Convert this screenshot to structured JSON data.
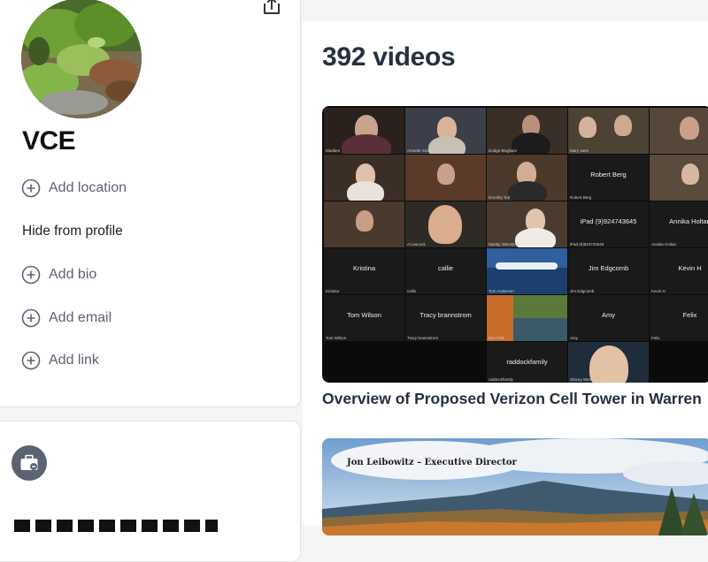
{
  "profile": {
    "name": "VCE",
    "add_location": "Add location",
    "hide_from_profile": "Hide from profile",
    "add_bio": "Add bio",
    "add_email": "Add email",
    "add_link": "Add link"
  },
  "main": {
    "video_count": "392 videos",
    "videos": [
      {
        "title": "Overview of Proposed Verizon Cell Tower in Warren",
        "participants": [
          "Kristina",
          "callie",
          "Jim Edgcomb",
          "Kevin H",
          "Tom Wilson",
          "Tracy brannstrom",
          "Amy",
          "Felix",
          "raddockfamily",
          "Robert Berg",
          "iPad (9)924743645",
          "Annika Holtan"
        ],
        "participant_captions": [
          "Kristina",
          "callie",
          "Tom Anderson",
          "Jim Edgcomb",
          "Kevin H",
          "Tom Wilson",
          "Tracy brannstrom",
          "Ben Falk",
          "Amy",
          "Felix",
          "raddockfamily",
          "Stacey Weston",
          "Robert Berg",
          "iPad (9)924743645",
          "Annika Holtan",
          "Dorothy Tod",
          "Maddy Weinstein",
          "A Leacock",
          "Dodge Bingham",
          "Mary Jane",
          "Annette Smith",
          "Madden"
        ]
      },
      {
        "overlay_text": "Jon Leibowitz – Executive Director"
      }
    ]
  },
  "colors": {
    "page_bg": "#f5f5f5",
    "heading_text": "#253040",
    "muted_icon": "#5d6472",
    "briefcase_bg": "#5b6270"
  },
  "icons": {
    "share": "share-upload-icon",
    "add": "plus-circle-icon",
    "briefcase": "briefcase-icon"
  }
}
